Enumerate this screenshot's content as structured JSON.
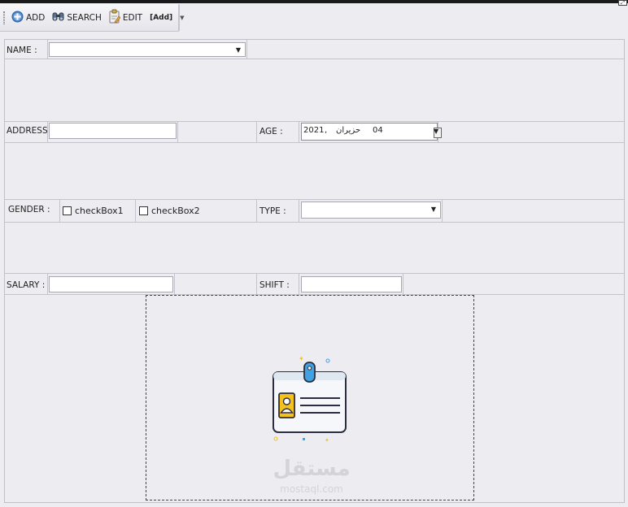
{
  "toolbar": {
    "add_label": "ADD",
    "search_label": "SEARCH",
    "edit_label": "EDIT",
    "mode_label": "[Add]",
    "icons": [
      "plus-circle-icon",
      "binoculars-icon",
      "clipboard-pencil-icon",
      "chevron-down-icon"
    ]
  },
  "form": {
    "name_label": "NAME :",
    "name_value": "",
    "address_label": "ADDRESS :",
    "address_value": "",
    "age_label": "AGE :",
    "age_year": "2021",
    "age_sep": ",",
    "age_month": "حزيران",
    "age_day": "04",
    "gender_label": "GENDER :",
    "checkbox1_label": "checkBox1",
    "checkbox1_checked": false,
    "checkbox2_label": "checkBox2",
    "checkbox2_checked": false,
    "type_label": "TYPE :",
    "type_value": "",
    "salary_label": "SALARY :",
    "salary_value": "",
    "shift_label": "SHIFT :",
    "shift_value": ""
  },
  "picture": {
    "icon": "id-badge-icon",
    "watermark_arabic": "مستقل",
    "watermark_latin": "mostaql.com"
  },
  "colors": {
    "background": "#ececf1",
    "grid_line": "#c2c3cb",
    "badge_blue": "#3fa3e3",
    "badge_yellow": "#f4c21b",
    "badge_navy": "#2b2d42"
  }
}
